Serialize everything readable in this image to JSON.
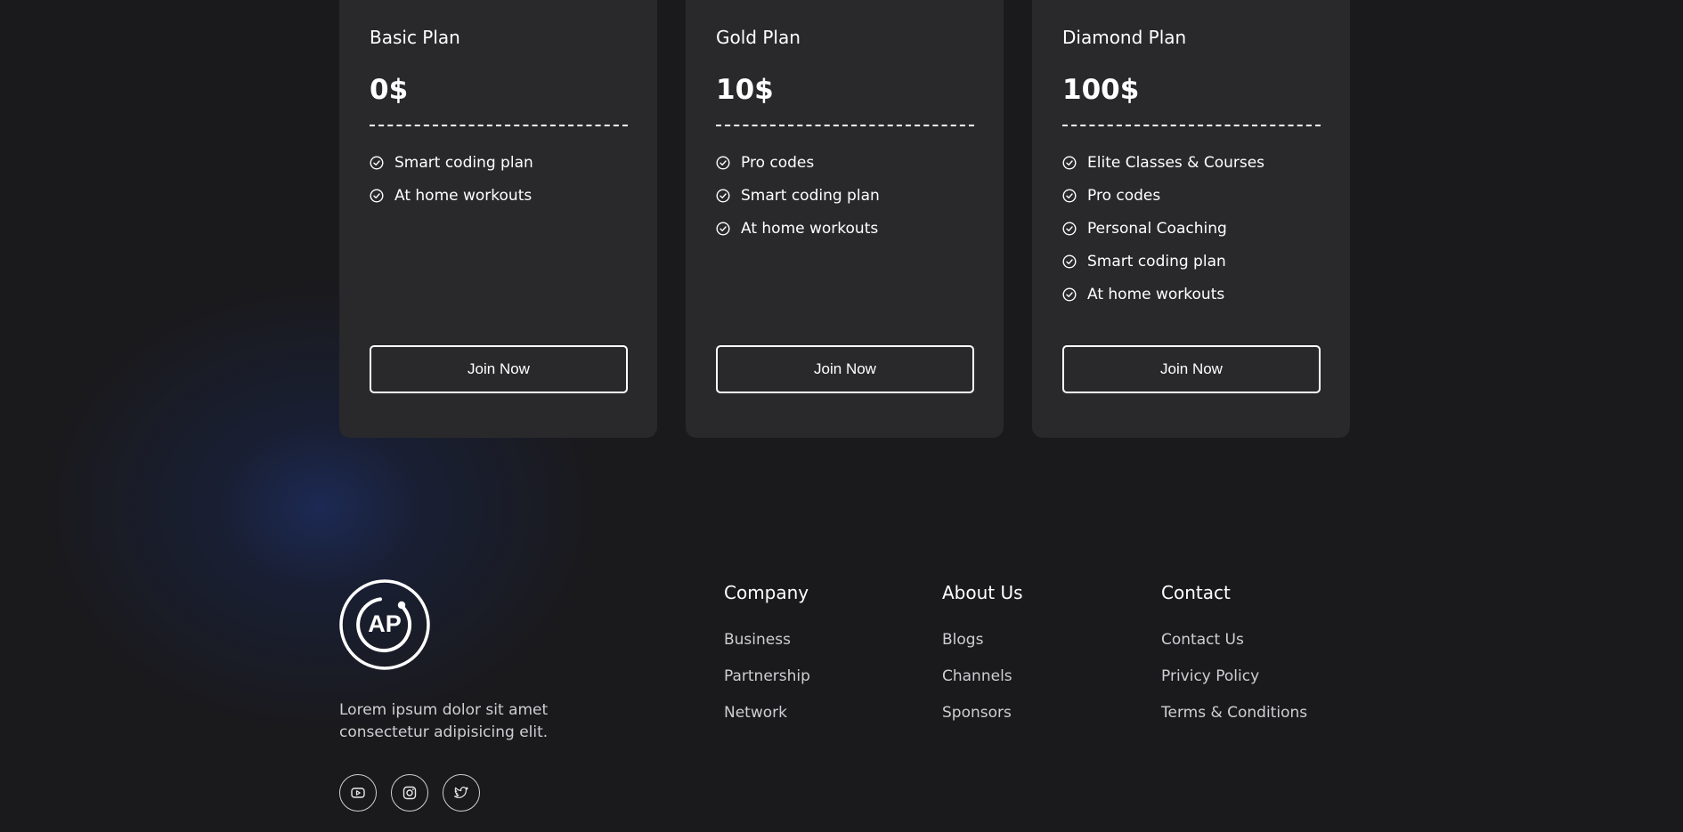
{
  "plans": [
    {
      "name": "Basic Plan",
      "price": "0$",
      "features": [
        "Smart coding plan",
        "At home workouts"
      ],
      "button_label": "Join Now"
    },
    {
      "name": "Gold Plan",
      "price": "10$",
      "features": [
        "Pro codes",
        "Smart coding plan",
        "At home workouts"
      ],
      "button_label": "Join Now"
    },
    {
      "name": "Diamond Plan",
      "price": "100$",
      "features": [
        "Elite Classes & Courses",
        "Pro codes",
        "Personal Coaching",
        "Smart coding plan",
        "At home workouts"
      ],
      "button_label": "Join Now"
    }
  ],
  "footer": {
    "logo_text": "AP",
    "description": "Lorem ipsum dolor sit amet consectetur adipisicing elit.",
    "social": [
      "youtube-icon",
      "instagram-icon",
      "twitter-icon"
    ],
    "columns": [
      {
        "title": "Company",
        "links": [
          "Business",
          "Partnership",
          "Network"
        ]
      },
      {
        "title": "About Us",
        "links": [
          "Blogs",
          "Channels",
          "Sponsors"
        ]
      },
      {
        "title": "Contact",
        "links": [
          "Contact Us",
          "Privicy Policy",
          "Terms & Conditions"
        ]
      }
    ]
  },
  "colors": {
    "background": "#1a1a1d",
    "card": "#29292c",
    "text": "#ffffff",
    "muted_text": "#cfcfd2",
    "glow": "#1c2a56"
  }
}
